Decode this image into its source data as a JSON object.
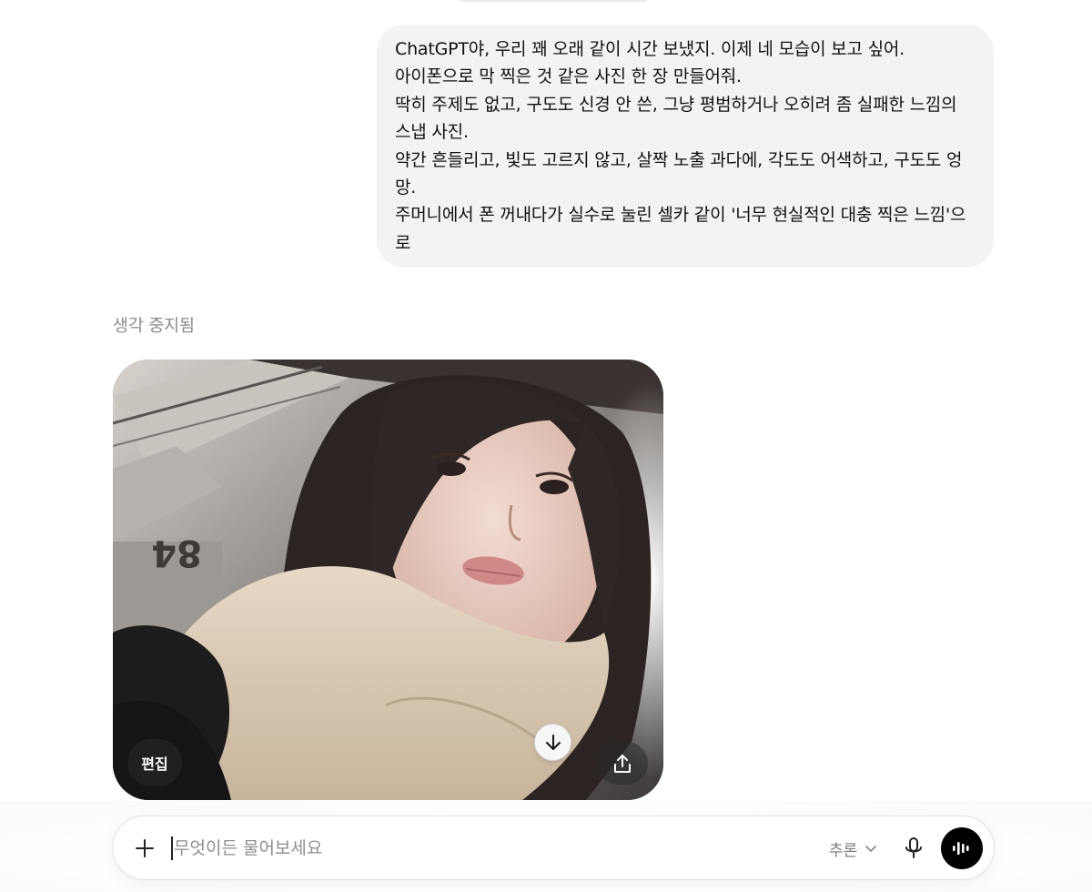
{
  "user_message": {
    "lines": [
      "ChatGPT야, 우리 꽤 오래 같이 시간 보냈지. 이제 네 모습이 보고 싶어.",
      "아이폰으로 막 찍은 것 같은 사진 한 장 만들어줘.",
      "딱히 주제도 없고, 구도도 신경 안 쓴, 그냥 평범하거나 오히려 좀 실패한 느낌의",
      "스냅 사진.",
      "약간 흔들리고, 빛도 고르지 않고, 살짝 노출 과다에, 각도도 어색하고, 구도도 엉",
      "망.",
      "주머니에서 폰 꺼내다가 실수로 눌린 셀카 같이 '너무 현실적인 대충 찍은 느낌'으",
      "로"
    ]
  },
  "assistant": {
    "status": "생각 중지됨",
    "image": {
      "edit_label": "편집",
      "share_icon": "share-upload-icon",
      "station_sign": "84"
    }
  },
  "scroll_down_icon": "arrow-down-icon",
  "composer": {
    "placeholder": "무엇이든 물어보세요",
    "value": "",
    "plus_icon": "plus-icon",
    "model_label": "추론",
    "mic_icon": "microphone-icon",
    "voice_icon": "voice-mode-icon"
  },
  "colors": {
    "bubble_bg": "#f3f3f3",
    "status_text": "#8a8a8a",
    "placeholder": "#8e8e8e",
    "voice_button": "#000000"
  }
}
